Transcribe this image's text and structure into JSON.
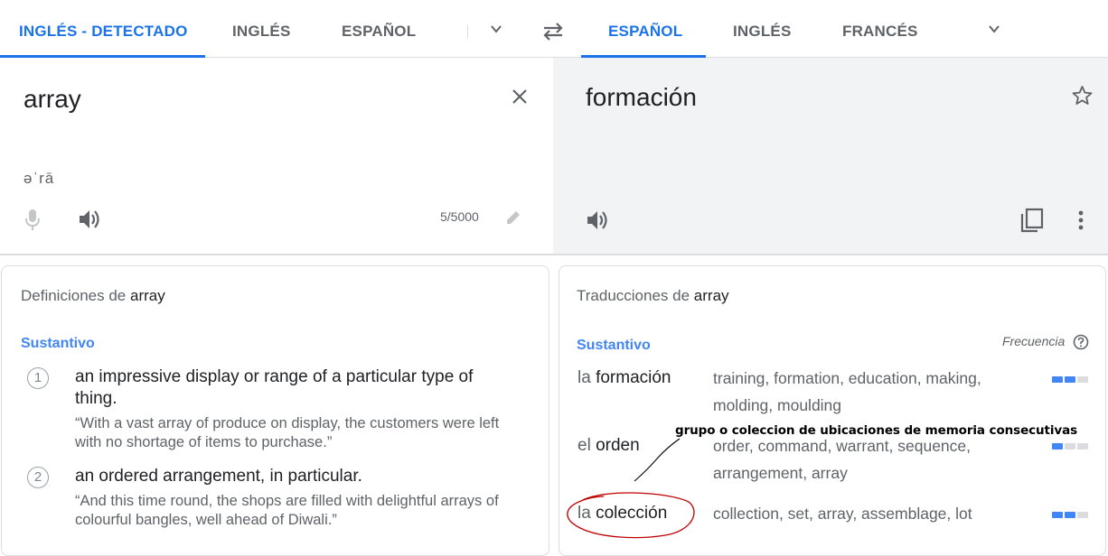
{
  "source_langs": [
    "INGLÉS - DETECTADO",
    "INGLÉS",
    "ESPAÑOL"
  ],
  "target_langs": [
    "ESPAÑOL",
    "INGLÉS",
    "FRANCÉS"
  ],
  "source": {
    "text": "array",
    "transliteration": "əˈrā",
    "char_count": "5/5000"
  },
  "target": {
    "text": "formación"
  },
  "definitions": {
    "title_prefix": "Definiciones de",
    "title_word": "array",
    "pos": "Sustantivo",
    "items": [
      {
        "number": "1",
        "text": "an impressive display or range of a particular type of thing.",
        "example": "“With a vast array of produce on display, the customers were left with no shortage of items to purchase.”"
      },
      {
        "number": "2",
        "text": "an ordered arrangement, in particular.",
        "example": "“And this time round, the shops are filled with delightful arrays of colourful bangles, well ahead of Diwali.”"
      }
    ]
  },
  "translations": {
    "title_prefix": "Traducciones de",
    "title_word": "array",
    "pos": "Sustantivo",
    "frequency_label": "Frecuencia",
    "rows": [
      {
        "article": "la",
        "word": "formación",
        "synonyms": "training, formation, education, making, molding, moulding",
        "frequency": 2
      },
      {
        "article": "el",
        "word": "orden",
        "synonyms": "order, command, warrant, sequence, arrangement, array",
        "frequency": 1
      },
      {
        "article": "la",
        "word": "colección",
        "synonyms": "collection, set, array, assemblage, lot",
        "frequency": 2
      }
    ]
  },
  "annotation": "grupo o coleccion de ubicaciones de memoria consecutivas",
  "icons": [
    "chevron-down-icon",
    "swap-icon",
    "close-icon",
    "mic-icon",
    "speaker-icon",
    "pencil-icon",
    "star-icon",
    "copy-icon",
    "more-vert-icon",
    "help-icon"
  ],
  "colors": {
    "accent": "#1a73e8",
    "pos_blue": "#4285f4",
    "freq_off": "#dadce0",
    "annotation_red": "#c00000"
  }
}
